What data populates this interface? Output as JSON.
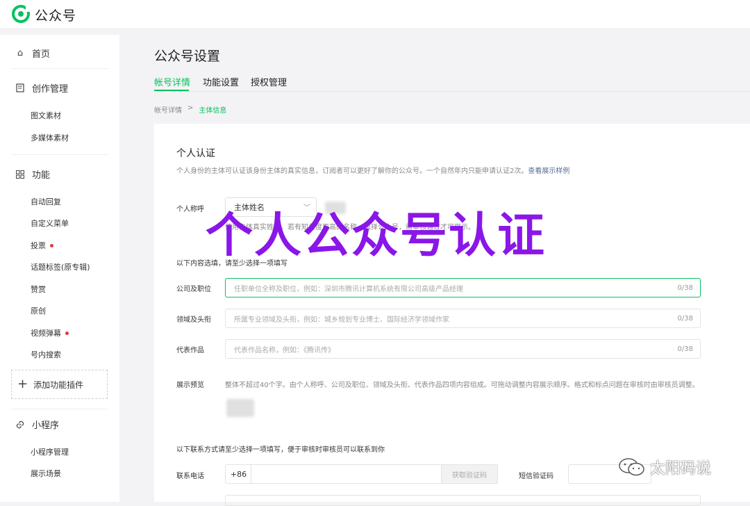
{
  "app": {
    "name": "公众号"
  },
  "sidebar": {
    "home": "首页",
    "creation": {
      "label": "创作管理",
      "items": [
        "图文素材",
        "多媒体素材"
      ]
    },
    "features": {
      "label": "功能",
      "items": [
        {
          "label": "自动回复",
          "dot": false
        },
        {
          "label": "自定义菜单",
          "dot": false
        },
        {
          "label": "投票",
          "dot": true
        },
        {
          "label": "话题标签(原专辑)",
          "dot": false
        },
        {
          "label": "赞赏",
          "dot": false
        },
        {
          "label": "原创",
          "dot": false
        },
        {
          "label": "视频弹幕",
          "dot": true
        },
        {
          "label": "号内搜索",
          "dot": false
        }
      ]
    },
    "add_plugin": "添加功能插件",
    "miniprogram": {
      "label": "小程序",
      "items": [
        "小程序管理",
        "展示场景"
      ]
    }
  },
  "page": {
    "title": "公众号设置",
    "tabs": [
      "帐号详情",
      "功能设置",
      "授权管理"
    ],
    "active_tab": 0,
    "breadcrumb": {
      "parent": "帐号详情",
      "sep": ">",
      "current": "主体信息"
    }
  },
  "section": {
    "title": "个人认证",
    "desc": "个人身份的主体可认证该身份主体的真实信息，订阅者可以更好了解你的公众号。一个自然年内只能申请认证2次。",
    "desc_link": "查看展示样例"
  },
  "form": {
    "nickname_label": "个人称呼",
    "nickname_select": "主体姓名",
    "nickname_hint": "使用主体真实姓名。若有知名度更高的名称，选择公众号，需审核通过才可展示。",
    "section_note": "以下内容选填，请至少选择一项填写",
    "fields": [
      {
        "label": "公司及职位",
        "placeholder": "任职单位全称及职位，例如：深圳市腾讯计算机系统有限公司高级产品经理",
        "count": "0/38"
      },
      {
        "label": "领域及头衔",
        "placeholder": "所属专业领域及头衔，例如：城乡规划专业博士、国际经济学领域作家",
        "count": "0/38"
      },
      {
        "label": "代表作品",
        "placeholder": "代表作品名称，例如：《腾讯传》",
        "count": "0/38"
      }
    ],
    "preview_label": "展示预览",
    "preview_text": "整体不超过40个字。由个人称呼、公司及职位、领域及头衔、代表作品四项内容组成。可拖动调整内容展示顺序。格式和标点问题在审核时由审核员调整。",
    "contact_note": "以下联系方式请至少选择一项填写，便于审核时审核员可以联系到你",
    "phone_label": "联系电话",
    "phone_prefix": "+86",
    "get_code": "获取验证码",
    "sms_label": "短信验证码"
  },
  "overlay": {
    "title": "个人公众号认证"
  },
  "watermark": {
    "text": "太阳码说"
  },
  "colors": {
    "accent": "#07c160",
    "overlay": "#8a16e8",
    "link": "#576b95",
    "dot": "#e53935"
  }
}
